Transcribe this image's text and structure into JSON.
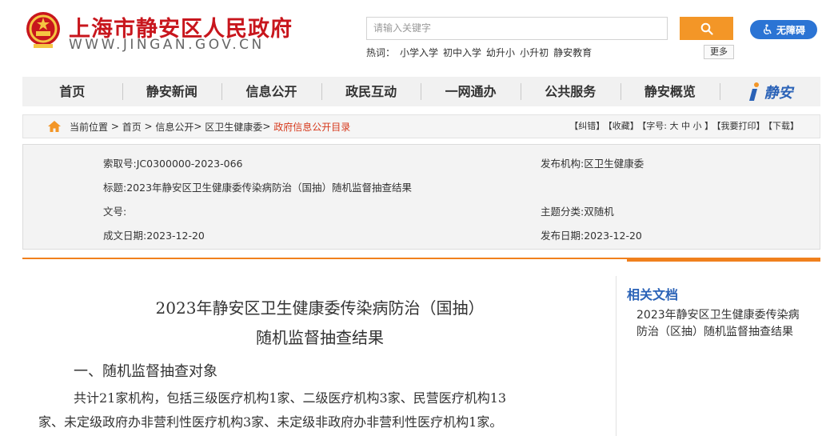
{
  "header": {
    "site_title": "上海市静安区人民政府",
    "site_url": "WWW.JINGAN.GOV.CN",
    "search_placeholder": "请输入关键字",
    "accessibility_label": "无障碍",
    "hot_label": "热词：",
    "hot_words": [
      "小学入学",
      "初中入学",
      "幼升小",
      "小升初",
      "静安教育"
    ],
    "more_label": "更多"
  },
  "nav": {
    "items": [
      "首页",
      "静安新闻",
      "信息公开",
      "政民互动",
      "一网通办",
      "公共服务",
      "静安概览"
    ],
    "logo_text": "静安"
  },
  "breadcrumb": {
    "prefix": "当前位置",
    "items": [
      "首页",
      "信息公开",
      "区卫生健康委"
    ],
    "current": "政府信息公开目录",
    "tools": [
      "【纠错】",
      "【收藏】",
      "【字号: 大 中 小 】",
      "【我要打印】",
      "【下载】"
    ]
  },
  "meta": {
    "index_no": "索取号:JC0300000-2023-066",
    "publisher": "发布机构:区卫生健康委",
    "title": "标题:2023年静安区卫生健康委传染病防治（国抽）随机监督抽查结果",
    "doc_no": "文号:",
    "topic": "主题分类:双随机",
    "created": "成文日期:2023-12-20",
    "published": "发布日期:2023-12-20"
  },
  "article": {
    "title_line1": "2023年静安区卫生健康委传染病防治（国抽）",
    "title_line2": "随机监督抽查结果",
    "section1_heading": "一、随机监督抽查对象",
    "para1_line1": "共计21家机构，包括三级医疗机构1家、二级医疗机构3家、民营医疗机构13",
    "para1_line2": "家、未定级政府办非营利性医疗机构3家、未定级非政府办非营利性医疗机构1家。"
  },
  "related": {
    "heading": "相关文档",
    "item1_line1": "2023年静安区卫生健康委传染病",
    "item1_line2": "防治（区抽）随机监督抽查结果"
  },
  "colors": {
    "brand_red": "#c8161d",
    "accent_orange": "#f39627",
    "accent_blue": "#2b74d4",
    "link_blue": "#2a62b7"
  }
}
